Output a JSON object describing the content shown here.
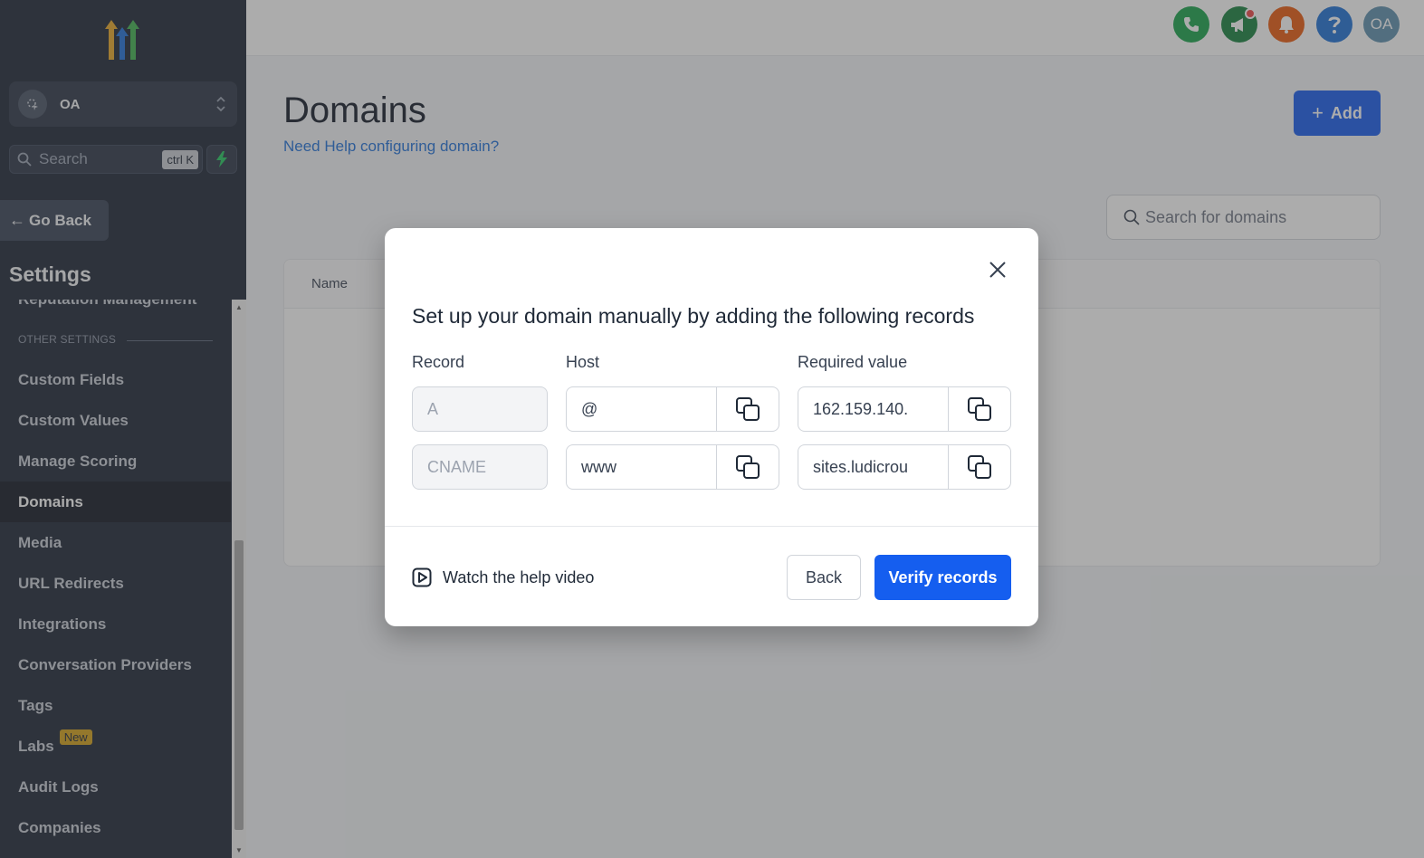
{
  "sidebar": {
    "account_name": "OA",
    "search_placeholder": "Search",
    "search_shortcut": "ctrl K",
    "go_back": "Go Back",
    "settings_title": "Settings",
    "partial_item": "Reputation Management",
    "section_label": "OTHER SETTINGS",
    "items": [
      {
        "label": "Custom Fields",
        "active": false
      },
      {
        "label": "Custom Values",
        "active": false
      },
      {
        "label": "Manage Scoring",
        "active": false
      },
      {
        "label": "Domains",
        "active": true
      },
      {
        "label": "Media",
        "active": false
      },
      {
        "label": "URL Redirects",
        "active": false
      },
      {
        "label": "Integrations",
        "active": false
      },
      {
        "label": "Conversation Providers",
        "active": false
      },
      {
        "label": "Tags",
        "active": false
      },
      {
        "label": "Labs",
        "active": false
      },
      {
        "label": "Audit Logs",
        "active": false
      },
      {
        "label": "Companies",
        "active": false
      }
    ],
    "labs_badge": "New"
  },
  "topbar": {
    "user_initials": "OA",
    "icons": [
      "phone-icon",
      "megaphone-icon",
      "bell-icon",
      "help-icon",
      "user-avatar"
    ],
    "colors": {
      "phone": "#16a34a",
      "megaphone": "#15803d",
      "bell": "#ea580c",
      "help": "#1d6fd6",
      "avatar": "#5b8fae"
    }
  },
  "main": {
    "title": "Domains",
    "help_link": "Need Help configuring domain?",
    "add_button": "Add",
    "search_placeholder": "Search for domains",
    "table_headers": [
      "Name"
    ]
  },
  "modal": {
    "title": "Set up your domain manually by adding the following records",
    "columns": {
      "record": "Record",
      "host": "Host",
      "value": "Required value"
    },
    "rows": [
      {
        "record": "A",
        "host": "@",
        "value": "162.159.140."
      },
      {
        "record": "CNAME",
        "host": "www",
        "value": "sites.ludicrou"
      }
    ],
    "help_video": "Watch the help video",
    "back_button": "Back",
    "verify_button": "Verify records"
  },
  "colors": {
    "sidebar_bg": "#1b2333",
    "primary": "#155eef",
    "labs_badge": "#d4a017"
  }
}
